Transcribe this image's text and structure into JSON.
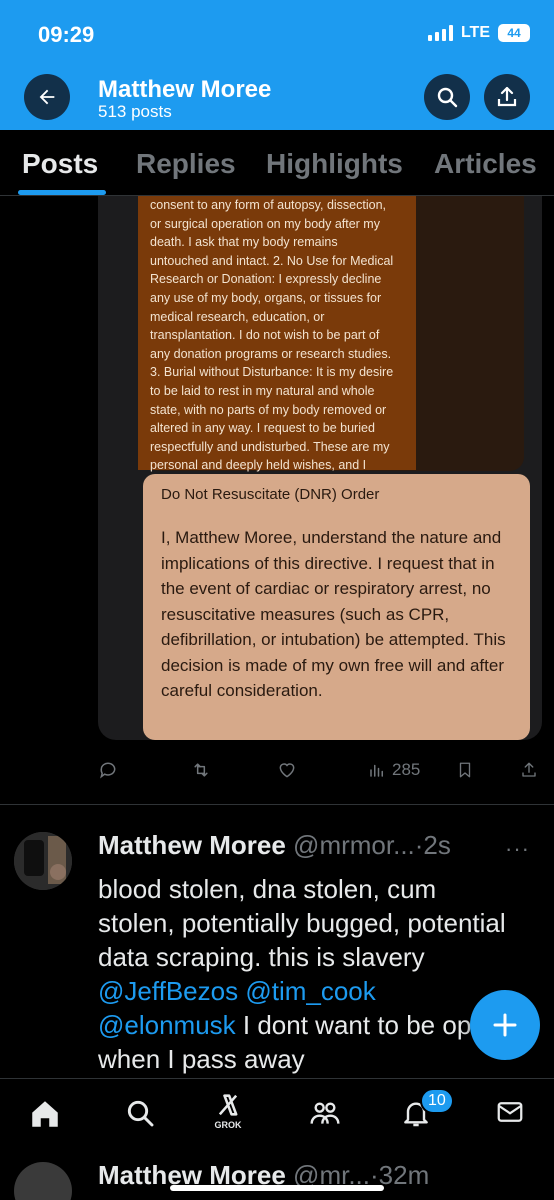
{
  "status_bar": {
    "time": "09:29",
    "network": "LTE",
    "battery": "44"
  },
  "header": {
    "name": "Matthew Moree",
    "post_count": "513 posts"
  },
  "tabs": [
    {
      "label": "Posts",
      "active": true
    },
    {
      "label": "Replies",
      "active": false
    },
    {
      "label": "Highlights",
      "active": false
    },
    {
      "label": "Articles",
      "active": false
    }
  ],
  "media": {
    "brown_doc_lines": [
      "consent to any form of autopsy, dissection,",
      "or surgical operation on my body after my",
      "death. I ask that my body remains",
      "untouched and intact. 2. No Use for Medical",
      "Research or Donation: I expressly decline",
      "any use of my body, organs, or tissues for",
      "medical research, education, or",
      "transplantation. I do not wish to be part of",
      "any donation programs or research studies.",
      "3. Burial without Disturbance: It is my desire",
      "to be laid to rest in my natural and whole",
      "state, with no parts of my body removed or",
      "altered in any way. I request to be buried",
      "respectfully and undisturbed. These are my",
      "personal and deeply held wishes, and I"
    ],
    "pink_doc_title": "Do Not Resuscitate (DNR) Order",
    "pink_doc_body": "I, Matthew Moree, understand the nature and implications of this directive. I request that in the event of cardiac or respiratory arrest, no resuscitative measures (such as CPR, defibrillation, or intubation) be attempted. This decision is made of my own free will and after careful consideration."
  },
  "post_actions": {
    "views": "285"
  },
  "tweet": {
    "name": "Matthew Moree",
    "handle_time": "@mrmor...·2s",
    "more": "···",
    "text_1": "blood stolen, dna stolen, cum stolen, potentially bugged, potential data scraping. this is slavery ",
    "mention_1": "@JeffBezos",
    "mention_2": "@tim_cook",
    "mention_3": "@elonmusk",
    "text_2": " I dont want to be open when I pass away"
  },
  "bottom_nav": {
    "grok_label": "GROK",
    "notifications_badge": "10"
  },
  "next_tweet": {
    "name": "Matthew Moree",
    "handle_time": "@mr...·32m"
  },
  "colors": {
    "accent": "#1d9bf0",
    "background": "#000000",
    "muted": "#71767b"
  },
  "icons": [
    "back-arrow-icon",
    "search-icon",
    "share-icon",
    "reply-icon",
    "repost-icon",
    "like-icon",
    "views-icon",
    "bookmark-icon",
    "plus-icon",
    "home-icon",
    "grok-icon",
    "communities-icon",
    "bell-icon",
    "mail-icon"
  ]
}
